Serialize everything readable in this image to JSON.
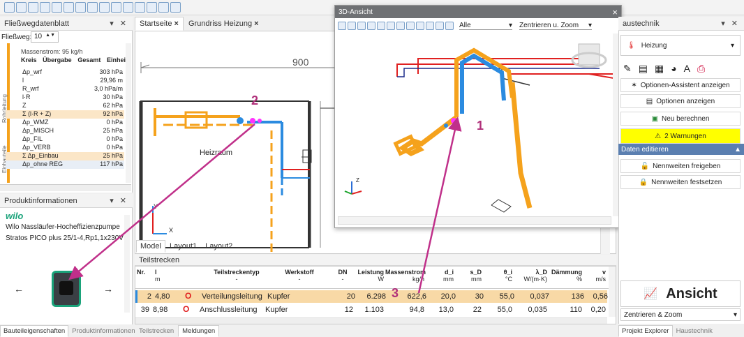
{
  "left_top_panel": {
    "title": "Fließwegdatenblatt",
    "flow_label": "Fließweg:",
    "flow_value": "10",
    "massenstrom": "Massenstrom: 95 kg/h",
    "cols": [
      "Kreis",
      "Übergabe",
      "Gesamt",
      "Einhei"
    ],
    "group1": "Rohrleitung",
    "group2": "Einbauteile",
    "rows": [
      {
        "name": "Δp_wrf",
        "value": "303 hPa"
      },
      {
        "name": "l",
        "value": "29,96 m"
      },
      {
        "name": "R_wrf",
        "value": "3,0 hPa/m"
      },
      {
        "name": "l·R",
        "value": "30 hPa"
      },
      {
        "name": "Z",
        "value": "62 hPa"
      },
      {
        "name": "Σ (l·R + Z)",
        "value": "92 hPa"
      },
      {
        "name": "Δp_WMZ",
        "value": "0 hPa"
      },
      {
        "name": "Δp_MISCH",
        "value": "25 hPa"
      },
      {
        "name": "Δp_FIL",
        "value": "0 hPa"
      },
      {
        "name": "Δp_VERB",
        "value": "0 hPa"
      },
      {
        "name": "Σ Δp_Einbau",
        "value": "25 hPa"
      },
      {
        "name": "Δp_ohne REG",
        "value": "117 hPa"
      }
    ]
  },
  "product_panel": {
    "title": "Produktinformationen",
    "brand": "wilo",
    "line1": "Wilo Nassläufer-Hocheffizienzpumpe",
    "line2": "Stratos PICO plus 25/1-4,Rp1,1x230V",
    "prev": "←",
    "next": "→"
  },
  "left_bottom_tabs": [
    "Bauteileigenschaften",
    "Produktinformationen"
  ],
  "center_tabs": [
    {
      "label": "Startseite",
      "close": "×"
    },
    {
      "label": "Grundriss Heizung",
      "close": "×"
    }
  ],
  "drawing": {
    "dim": "900",
    "room": "Heizraum",
    "axis_y": "Y",
    "axis_x": "X",
    "layout_tabs": [
      "Model",
      "Layout1",
      "Layout2"
    ]
  },
  "view3d": {
    "title": "3D-Ansicht",
    "close": "×",
    "filter": "Alle",
    "zoom": "Zentrieren u. Zoom",
    "axis": "Z"
  },
  "annotations": [
    "2",
    "1",
    "3"
  ],
  "teilstrecken": {
    "title": "Teilstrecken",
    "headers": [
      [
        "Nr.",
        ""
      ],
      [
        "l",
        "m"
      ],
      [
        "",
        ""
      ],
      [
        "Teilstreckentyp",
        "-"
      ],
      [
        "Werkstoff",
        "-"
      ],
      [
        "DN",
        "-"
      ],
      [
        "Leistung",
        "W"
      ],
      [
        "Massenstrom",
        "kg/h"
      ],
      [
        "d_i",
        "mm"
      ],
      [
        "s_D",
        "mm"
      ],
      [
        "θ_i",
        "°C"
      ],
      [
        "λ_D",
        "W/(m·K)"
      ],
      [
        "Dämmung",
        "%"
      ],
      [
        "v",
        "m/s"
      ]
    ],
    "rows": [
      [
        "2",
        "4,80",
        "O",
        "Verteilungsleitung",
        "Kupfer",
        "20",
        "6.298",
        "622,6",
        "20,0",
        "30",
        "55,0",
        "0,037",
        "136",
        "0,56"
      ],
      [
        "39",
        "8,98",
        "O",
        "Anschlussleitung",
        "Kupfer",
        "12",
        "1.103",
        "94,8",
        "13,0",
        "22",
        "55,0",
        "0,035",
        "110",
        "0,20"
      ]
    ]
  },
  "bottom_tabs": [
    "Teilstrecken",
    "Meldungen"
  ],
  "right_panel": {
    "title": "austechnik",
    "system": "Heizung",
    "buttons": [
      "Optionen-Assistent anzeigen",
      "Optionen anzeigen",
      "Neu berechnen",
      "2 Warnungen"
    ],
    "section": "Daten editieren",
    "edit_buttons": [
      "Nennweiten freigeben",
      "Nennweiten festsetzen"
    ],
    "ansicht": "Ansicht",
    "zoom_select": "Zentrieren & Zoom",
    "tabs": [
      "Projekt Explorer",
      "Haustechnik"
    ]
  },
  "colors": {
    "accent": "#f5a21c",
    "pipe_blue": "#2b8be0",
    "pipe_red": "#e02020",
    "arrow": "#c0308a",
    "warn": "#ffff00"
  }
}
